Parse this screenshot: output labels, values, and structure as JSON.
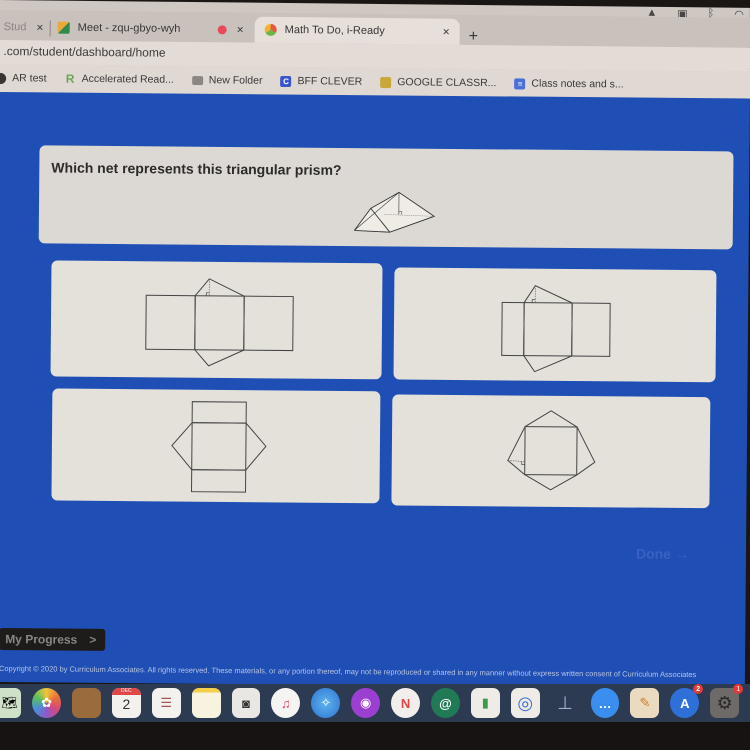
{
  "menubar": {
    "icons": [
      "airplay-icon",
      "display-icon",
      "bluetooth-icon",
      "wifi-icon"
    ]
  },
  "tabs": [
    {
      "label": "Stud",
      "close": "×",
      "favicon": "tab-favicon",
      "active": false
    },
    {
      "label": "Meet - zqu-gbyo-wyh",
      "close": "",
      "favicon": "google-meet-icon",
      "active": false
    },
    {
      "label": "",
      "close": "×",
      "favicon": "recording-dot-icon",
      "active": false
    },
    {
      "label": "Math To Do, i-Ready",
      "close": "×",
      "favicon": "iready-icon",
      "active": true
    }
  ],
  "new_tab_label": "+",
  "url": ".com/student/dashboard/home",
  "bookmarks": [
    {
      "label": "AR test",
      "icon": "ar-icon"
    },
    {
      "label": "Accelerated Read...",
      "icon": "renaissance-r-icon"
    },
    {
      "label": "New Folder",
      "icon": "folder-icon"
    },
    {
      "label": "BFF CLEVER",
      "icon": "clever-icon"
    },
    {
      "label": "GOOGLE CLASSR...",
      "icon": "google-classroom-icon"
    },
    {
      "label": "Class notes and s...",
      "icon": "google-docs-icon"
    }
  ],
  "question": {
    "text": "Which net represents this triangular prism?"
  },
  "choices": [
    {
      "id": "A",
      "description": "Three rectangles in a row with triangles on top and bottom of the middle rectangle; top triangle has height marker"
    },
    {
      "id": "B",
      "description": "Three rectangles in a row (narrow side rectangles) with triangles on top and bottom of middle rectangle; top triangle has height marker"
    },
    {
      "id": "C",
      "description": "Three rectangles stacked vertically with triangles on left and right of middle rectangle"
    },
    {
      "id": "D",
      "description": "One square with triangles on all four sides; left triangle has height marker"
    }
  ],
  "done_button": "Done →",
  "my_progress": {
    "label": "My Progress",
    "chevron": ">"
  },
  "copyright": "Copyright © 2020 by Curriculum Associates. All rights reserved. These materials, or any portion thereof, may not be reproduced or shared in any manner without express written consent of Curriculum Associates",
  "dock": [
    {
      "name": "maps-icon",
      "glyph": "🗺"
    },
    {
      "name": "photos-icon",
      "glyph": "✿"
    },
    {
      "name": "contacts-icon",
      "glyph": ""
    },
    {
      "name": "calendar-icon",
      "glyph": "2",
      "month": "DEC"
    },
    {
      "name": "reminders-icon",
      "glyph": "☰"
    },
    {
      "name": "notes-icon",
      "glyph": ""
    },
    {
      "name": "screenshot-icon",
      "glyph": "◙"
    },
    {
      "name": "music-icon",
      "glyph": "♫"
    },
    {
      "name": "safari-icon",
      "glyph": "✧"
    },
    {
      "name": "podcasts-icon",
      "glyph": "◉"
    },
    {
      "name": "news-icon",
      "glyph": "N"
    },
    {
      "name": "hangouts-chat-icon",
      "glyph": "@"
    },
    {
      "name": "numbers-icon",
      "glyph": "▮"
    },
    {
      "name": "chrome-icon",
      "glyph": "◎"
    },
    {
      "name": "keynote-icon",
      "glyph": "⊥"
    },
    {
      "name": "messages-icon",
      "glyph": "…"
    },
    {
      "name": "pages-icon",
      "glyph": "✎"
    },
    {
      "name": "app-store-icon",
      "glyph": "A",
      "badge": "2"
    },
    {
      "name": "system-preferences-icon",
      "glyph": "⚙",
      "badge": "1"
    }
  ],
  "colors": {
    "page_bg": "#1f4fb4",
    "card_bg": "#e4e1db",
    "question_bg": "#dcd9d4",
    "done_disabled": "#3961c4"
  }
}
